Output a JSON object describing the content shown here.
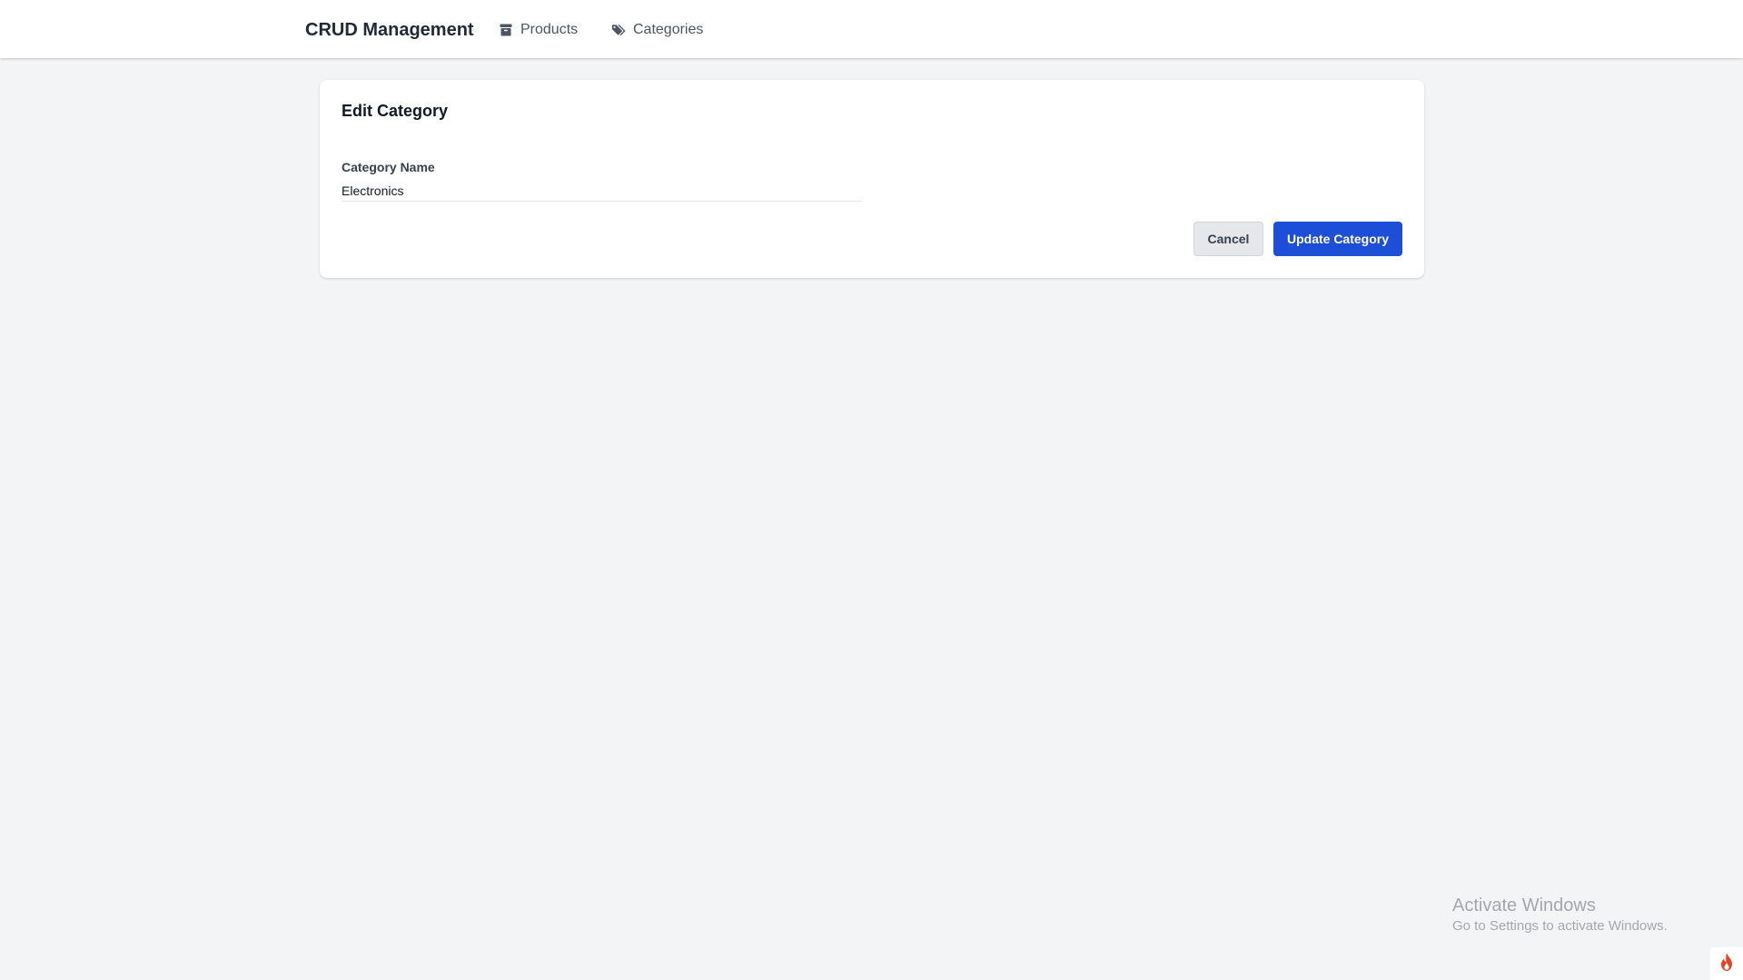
{
  "navbar": {
    "brand": "CRUD Management",
    "links": [
      {
        "label": "Products",
        "icon": "box-icon"
      },
      {
        "label": "Categories",
        "icon": "tags-icon"
      }
    ]
  },
  "form": {
    "title": "Edit Category",
    "category_name_label": "Category Name",
    "category_name_value": "Electronics",
    "cancel_label": "Cancel",
    "submit_label": "Update Category"
  },
  "watermark": {
    "title": "Activate Windows",
    "subtitle": "Go to Settings to activate Windows."
  },
  "colors": {
    "background": "#f3f4f6",
    "primary": "#1d4ed8",
    "cancel_bg": "#e5e7eb",
    "flame": "#e8431f"
  }
}
